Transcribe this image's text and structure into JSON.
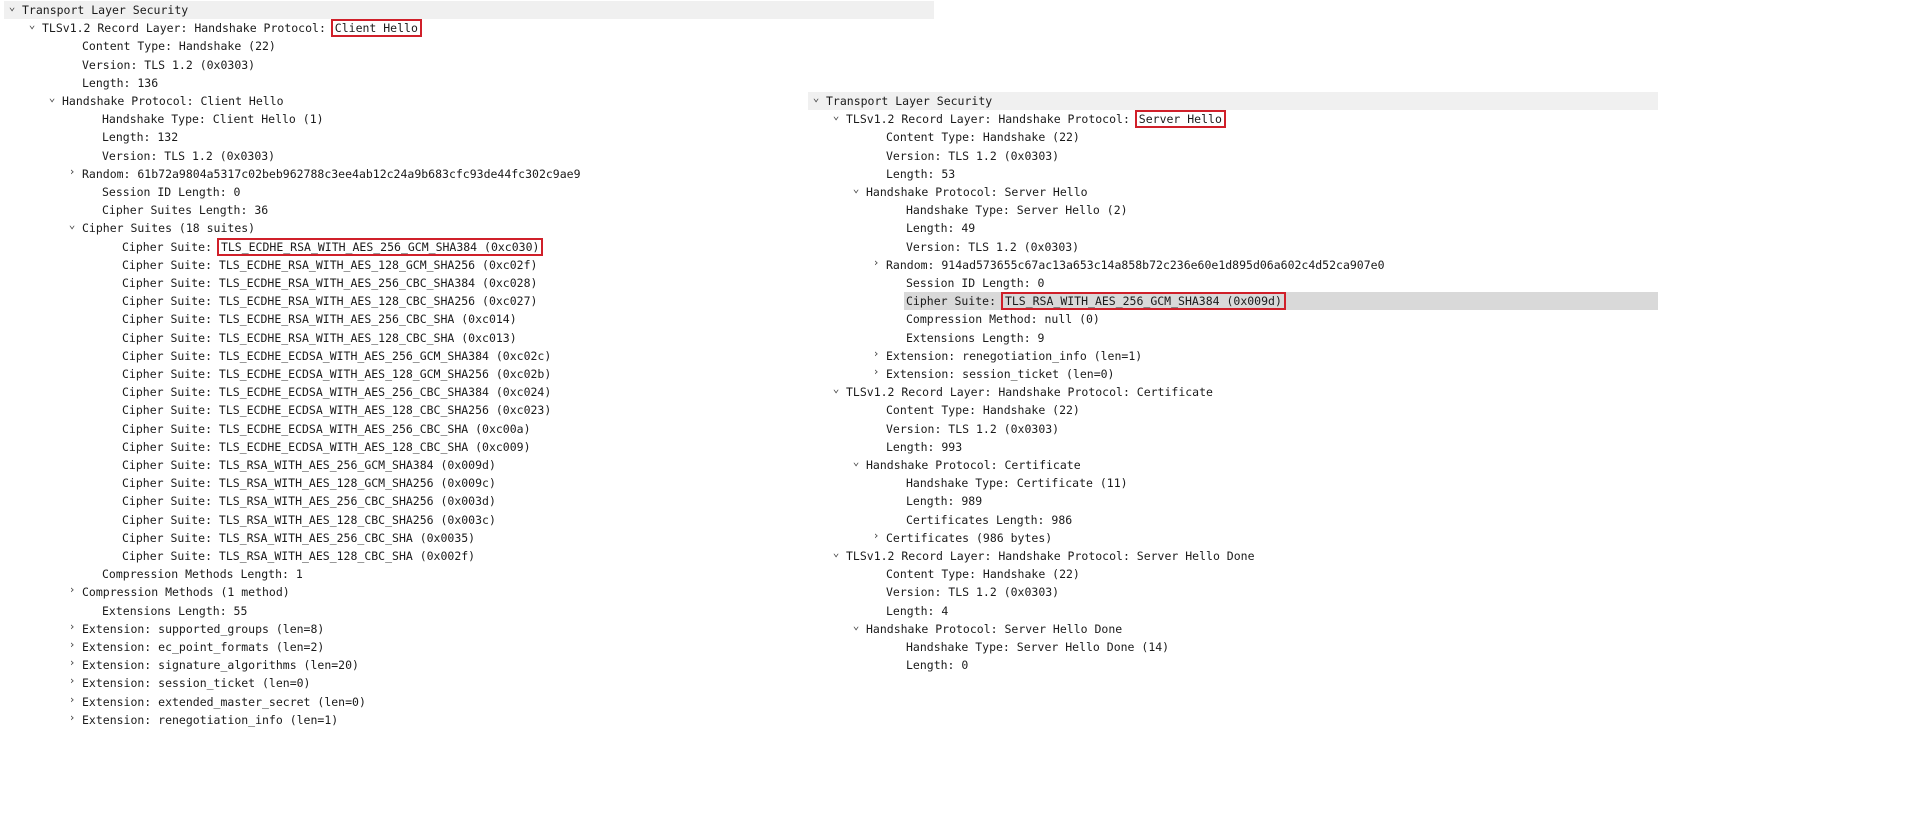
{
  "client": {
    "rows": [
      {
        "text": "Transport Layer Security",
        "lvl": 0,
        "arrow": "expanded"
      },
      {
        "text": "TLSv1.2 Record Layer: Handshake Protocol: ",
        "box": "Client Hello",
        "lvl": 1,
        "arrow": "expanded"
      },
      {
        "text": "Content Type: Handshake (22)",
        "lvl": 3
      },
      {
        "text": "Version: TLS 1.2 (0x0303)",
        "lvl": 3
      },
      {
        "text": "Length: 136",
        "lvl": 3
      },
      {
        "text": "Handshake Protocol: Client Hello",
        "lvl": 2,
        "arrow": "expanded"
      },
      {
        "text": "Handshake Type: Client Hello (1)",
        "lvl": 4
      },
      {
        "text": "Length: 132",
        "lvl": 4
      },
      {
        "text": "Version: TLS 1.2 (0x0303)",
        "lvl": 4
      },
      {
        "text": "Random: 61b72a9804a5317c02beb962788c3ee4ab12c24a9b683cfc93de44fc302c9ae9",
        "lvl": 3,
        "arrow": "collapsed"
      },
      {
        "text": "Session ID Length: 0",
        "lvl": 4
      },
      {
        "text": "Cipher Suites Length: 36",
        "lvl": 4
      },
      {
        "text": "Cipher Suites (18 suites)",
        "lvl": 3,
        "arrow": "expanded"
      },
      {
        "text": "Cipher Suite: ",
        "box": "TLS_ECDHE_RSA_WITH_AES_256_GCM_SHA384 (0xc030)",
        "lvl": 5
      },
      {
        "text": "Cipher Suite: TLS_ECDHE_RSA_WITH_AES_128_GCM_SHA256 (0xc02f)",
        "lvl": 5
      },
      {
        "text": "Cipher Suite: TLS_ECDHE_RSA_WITH_AES_256_CBC_SHA384 (0xc028)",
        "lvl": 5
      },
      {
        "text": "Cipher Suite: TLS_ECDHE_RSA_WITH_AES_128_CBC_SHA256 (0xc027)",
        "lvl": 5
      },
      {
        "text": "Cipher Suite: TLS_ECDHE_RSA_WITH_AES_256_CBC_SHA (0xc014)",
        "lvl": 5
      },
      {
        "text": "Cipher Suite: TLS_ECDHE_RSA_WITH_AES_128_CBC_SHA (0xc013)",
        "lvl": 5
      },
      {
        "text": "Cipher Suite: TLS_ECDHE_ECDSA_WITH_AES_256_GCM_SHA384 (0xc02c)",
        "lvl": 5
      },
      {
        "text": "Cipher Suite: TLS_ECDHE_ECDSA_WITH_AES_128_GCM_SHA256 (0xc02b)",
        "lvl": 5
      },
      {
        "text": "Cipher Suite: TLS_ECDHE_ECDSA_WITH_AES_256_CBC_SHA384 (0xc024)",
        "lvl": 5
      },
      {
        "text": "Cipher Suite: TLS_ECDHE_ECDSA_WITH_AES_128_CBC_SHA256 (0xc023)",
        "lvl": 5
      },
      {
        "text": "Cipher Suite: TLS_ECDHE_ECDSA_WITH_AES_256_CBC_SHA (0xc00a)",
        "lvl": 5
      },
      {
        "text": "Cipher Suite: TLS_ECDHE_ECDSA_WITH_AES_128_CBC_SHA (0xc009)",
        "lvl": 5
      },
      {
        "text": "Cipher Suite: TLS_RSA_WITH_AES_256_GCM_SHA384 (0x009d)",
        "lvl": 5
      },
      {
        "text": "Cipher Suite: TLS_RSA_WITH_AES_128_GCM_SHA256 (0x009c)",
        "lvl": 5
      },
      {
        "text": "Cipher Suite: TLS_RSA_WITH_AES_256_CBC_SHA256 (0x003d)",
        "lvl": 5
      },
      {
        "text": "Cipher Suite: TLS_RSA_WITH_AES_128_CBC_SHA256 (0x003c)",
        "lvl": 5
      },
      {
        "text": "Cipher Suite: TLS_RSA_WITH_AES_256_CBC_SHA (0x0035)",
        "lvl": 5
      },
      {
        "text": "Cipher Suite: TLS_RSA_WITH_AES_128_CBC_SHA (0x002f)",
        "lvl": 5
      },
      {
        "text": "Compression Methods Length: 1",
        "lvl": 4
      },
      {
        "text": "Compression Methods (1 method)",
        "lvl": 3,
        "arrow": "collapsed"
      },
      {
        "text": "Extensions Length: 55",
        "lvl": 4
      },
      {
        "text": "Extension: supported_groups (len=8)",
        "lvl": 3,
        "arrow": "collapsed"
      },
      {
        "text": "Extension: ec_point_formats (len=2)",
        "lvl": 3,
        "arrow": "collapsed"
      },
      {
        "text": "Extension: signature_algorithms (len=20)",
        "lvl": 3,
        "arrow": "collapsed"
      },
      {
        "text": "Extension: session_ticket (len=0)",
        "lvl": 3,
        "arrow": "collapsed"
      },
      {
        "text": "Extension: extended_master_secret (len=0)",
        "lvl": 3,
        "arrow": "collapsed"
      },
      {
        "text": "Extension: renegotiation_info (len=1)",
        "lvl": 3,
        "arrow": "collapsed"
      }
    ]
  },
  "server": {
    "rows": [
      {
        "text": "Transport Layer Security",
        "lvl": 0,
        "arrow": "expanded"
      },
      {
        "text": "TLSv1.2 Record Layer: Handshake Protocol: ",
        "box": "Server Hello",
        "lvl": 1,
        "arrow": "expanded"
      },
      {
        "text": "Content Type: Handshake (22)",
        "lvl": 3
      },
      {
        "text": "Version: TLS 1.2 (0x0303)",
        "lvl": 3
      },
      {
        "text": "Length: 53",
        "lvl": 3
      },
      {
        "text": "Handshake Protocol: Server Hello",
        "lvl": 2,
        "arrow": "expanded"
      },
      {
        "text": "Handshake Type: Server Hello (2)",
        "lvl": 4
      },
      {
        "text": "Length: 49",
        "lvl": 4
      },
      {
        "text": "Version: TLS 1.2 (0x0303)",
        "lvl": 4
      },
      {
        "text": "Random: 914ad573655c67ac13a653c14a858b72c236e60e1d895d06a602c4d52ca907e0",
        "lvl": 3,
        "arrow": "collapsed"
      },
      {
        "text": "Session ID Length: 0",
        "lvl": 4
      },
      {
        "text": "Cipher Suite: ",
        "box": "TLS_RSA_WITH_AES_256_GCM_SHA384 (0x009d)",
        "lvl": 4,
        "selected": true
      },
      {
        "text": "Compression Method: null (0)",
        "lvl": 4
      },
      {
        "text": "Extensions Length: 9",
        "lvl": 4
      },
      {
        "text": "Extension: renegotiation_info (len=1)",
        "lvl": 3,
        "arrow": "collapsed"
      },
      {
        "text": "Extension: session_ticket (len=0)",
        "lvl": 3,
        "arrow": "collapsed"
      },
      {
        "text": "TLSv1.2 Record Layer: Handshake Protocol: Certificate",
        "lvl": 1,
        "arrow": "expanded"
      },
      {
        "text": "Content Type: Handshake (22)",
        "lvl": 3
      },
      {
        "text": "Version: TLS 1.2 (0x0303)",
        "lvl": 3
      },
      {
        "text": "Length: 993",
        "lvl": 3
      },
      {
        "text": "Handshake Protocol: Certificate",
        "lvl": 2,
        "arrow": "expanded"
      },
      {
        "text": "Handshake Type: Certificate (11)",
        "lvl": 4
      },
      {
        "text": "Length: 989",
        "lvl": 4
      },
      {
        "text": "Certificates Length: 986",
        "lvl": 4
      },
      {
        "text": "Certificates (986 bytes)",
        "lvl": 3,
        "arrow": "collapsed"
      },
      {
        "text": "TLSv1.2 Record Layer: Handshake Protocol: Server Hello Done",
        "lvl": 1,
        "arrow": "expanded"
      },
      {
        "text": "Content Type: Handshake (22)",
        "lvl": 3
      },
      {
        "text": "Version: TLS 1.2 (0x0303)",
        "lvl": 3
      },
      {
        "text": "Length: 4",
        "lvl": 3
      },
      {
        "text": "Handshake Protocol: Server Hello Done",
        "lvl": 2,
        "arrow": "expanded"
      },
      {
        "text": "Handshake Type: Server Hello Done (14)",
        "lvl": 4
      },
      {
        "text": "Length: 0",
        "lvl": 4
      }
    ]
  },
  "colors": {
    "highlight_box": "#d0202a",
    "header_bg": "#f0f0f0",
    "selected_bg": "#d9d9d9"
  },
  "icons": {
    "expanded": "chevron-down-icon",
    "collapsed": "chevron-right-icon"
  }
}
